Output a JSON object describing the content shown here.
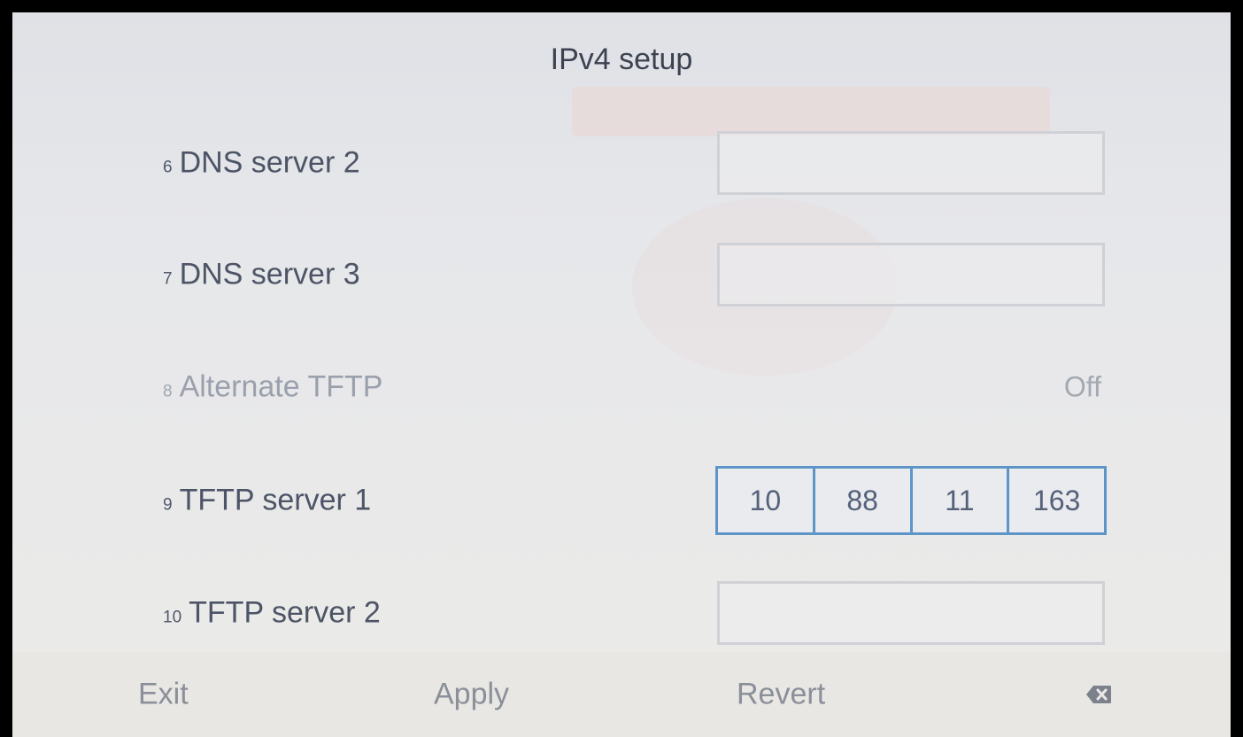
{
  "screen": {
    "title": "IPv4 setup"
  },
  "rows": [
    {
      "number": "6",
      "label": "DNS server 2",
      "kind": "empty-field"
    },
    {
      "number": "7",
      "label": "DNS server 3",
      "kind": "empty-field"
    },
    {
      "number": "8",
      "label": "Alternate TFTP",
      "kind": "toggle",
      "value": "Off"
    },
    {
      "number": "9",
      "label": "TFTP server 1",
      "kind": "ip-field",
      "octets": [
        "10",
        "88",
        "11",
        "163"
      ]
    },
    {
      "number": "10",
      "label": "TFTP server 2",
      "kind": "empty-field"
    }
  ],
  "softkeys": {
    "exit": "Exit",
    "apply": "Apply",
    "revert": "Revert",
    "backspace_icon": "backspace-icon"
  },
  "colors": {
    "focus_border": "#5d95c8",
    "label_text": "#4c5466",
    "dim_text": "#9aa0ac"
  }
}
